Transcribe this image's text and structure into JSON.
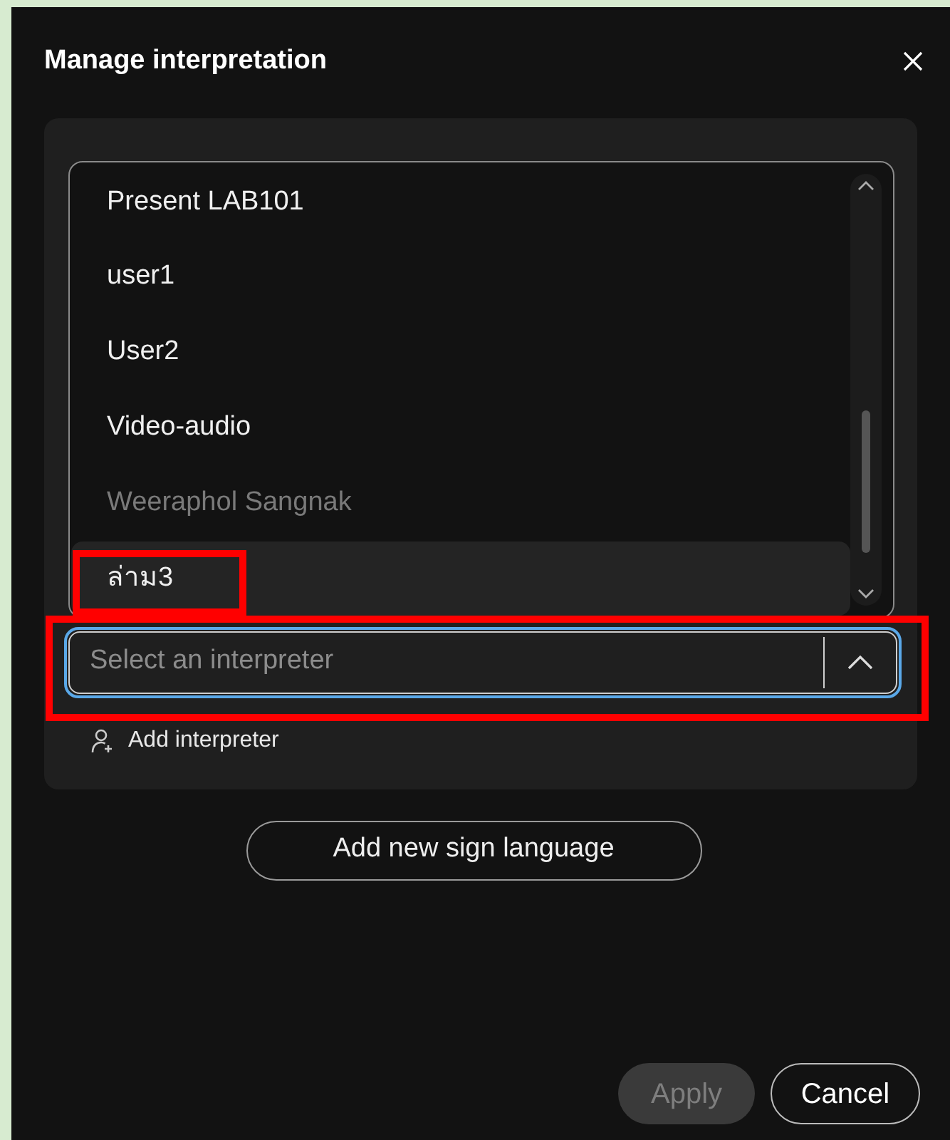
{
  "dialog": {
    "title": "Manage interpretation"
  },
  "interpreter_list": {
    "items": [
      {
        "label": "Present LAB101",
        "disabled": false,
        "highlighted": false,
        "marked": false
      },
      {
        "label": "user1",
        "disabled": false,
        "highlighted": false,
        "marked": false
      },
      {
        "label": "User2",
        "disabled": false,
        "highlighted": false,
        "marked": false
      },
      {
        "label": "Video-audio",
        "disabled": false,
        "highlighted": false,
        "marked": false
      },
      {
        "label": "Weeraphol Sangnak",
        "disabled": true,
        "highlighted": false,
        "marked": false
      },
      {
        "label": "ล่าม3",
        "disabled": false,
        "highlighted": true,
        "marked": true
      }
    ]
  },
  "interpreter_select": {
    "placeholder": "Select an interpreter",
    "focused": true,
    "marked": true
  },
  "add_interpreter": "Add interpreter",
  "add_sign_language": "Add new sign language",
  "buttons": [
    {
      "label": "Apply",
      "disabled": true
    },
    {
      "label": "Cancel",
      "disabled": false
    }
  ]
}
